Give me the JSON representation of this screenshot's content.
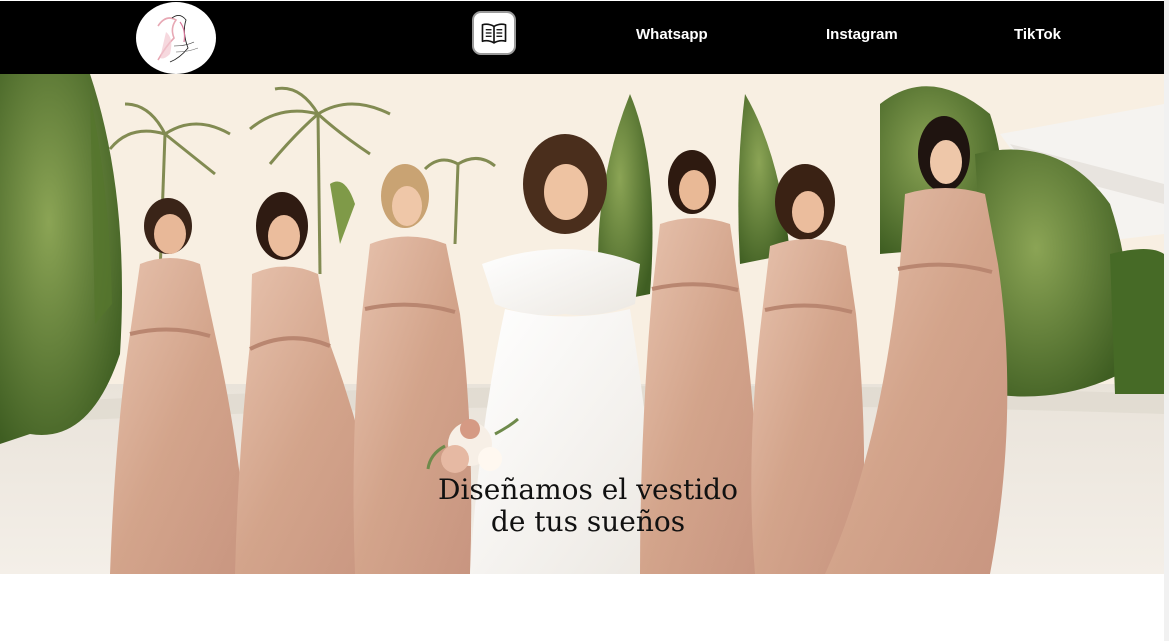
{
  "header": {
    "logo_icon": "brand-logo-icon",
    "book_icon": "open-book-icon",
    "links": [
      {
        "label": "Whatsapp"
      },
      {
        "label": "Instagram"
      },
      {
        "label": "TikTok"
      }
    ]
  },
  "hero": {
    "title_line1": "Diseñamos el vestido",
    "title_line2": "de tus sueños",
    "image_description_icon": "bridal-party-photo"
  },
  "colors": {
    "nav_background": "#000000",
    "nav_text": "#ffffff",
    "dress_pink": "#d8ae97",
    "bride_dress": "#fbfaf8",
    "hedge_green": "#4d6b2a",
    "title_text": "#111111"
  }
}
